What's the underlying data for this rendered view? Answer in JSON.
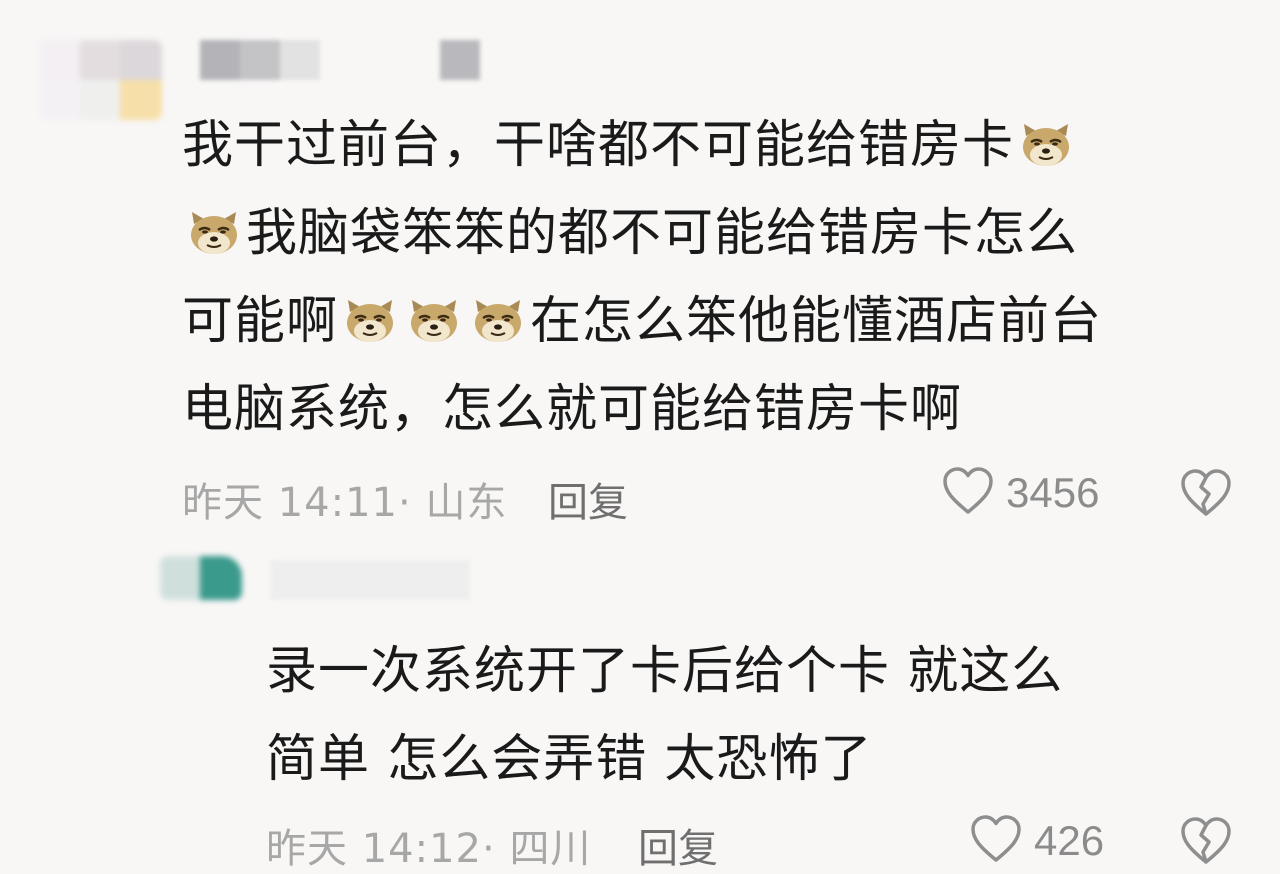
{
  "comments": [
    {
      "lines": [
        [
          "我干过前台，干啥都不可能给错房卡",
          "[doge]"
        ],
        [
          "[doge]",
          "我脑袋笨笨的都不可能给错房卡怎么"
        ],
        [
          "可能啊",
          "[doge]",
          "[doge]",
          "[doge]",
          "在怎么笨他能懂酒店前台"
        ],
        [
          "电脑系统，怎么就可能给错房卡啊"
        ]
      ],
      "time": "昨天 14:11",
      "separator": "·",
      "location": "山东",
      "reply_label": "回复",
      "likes": "3456"
    },
    {
      "lines": [
        [
          "录一次系统开了卡后给个卡 就这么"
        ],
        [
          "简单 怎么会弄错 太恐怖了"
        ]
      ],
      "time": "昨天 14:12",
      "separator": "·",
      "location": "四川",
      "reply_label": "回复",
      "likes": "426"
    }
  ],
  "icons": {
    "like": "heart-outline-icon",
    "dislike": "broken-heart-outline-icon",
    "emoji": "doge-emoji"
  },
  "colors": {
    "background": "#f8f7f6",
    "text": "#1a1a1a",
    "meta": "#a7a7a7",
    "reply": "#6f6f6f",
    "avatar_teal": "#3a9a8c"
  }
}
